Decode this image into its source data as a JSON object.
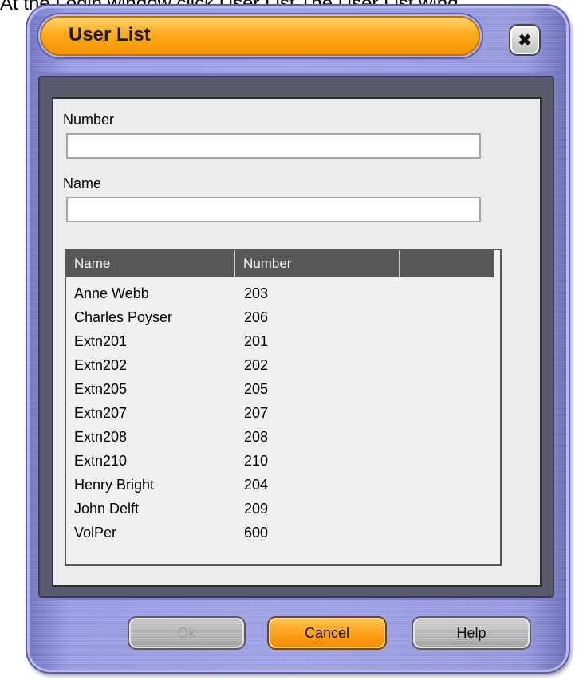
{
  "caption": "At the Login window click User List The User List wind",
  "window": {
    "title": "User List",
    "close_glyph": "✖"
  },
  "form": {
    "number_label": "Number",
    "number_value": "",
    "name_label": "Name",
    "name_value": ""
  },
  "list": {
    "columns": [
      "Name",
      "Number",
      ""
    ],
    "rows": [
      {
        "name": "Anne Webb",
        "number": "203"
      },
      {
        "name": "Charles Poyser",
        "number": "206"
      },
      {
        "name": "Extn201",
        "number": "201"
      },
      {
        "name": "Extn202",
        "number": "202"
      },
      {
        "name": "Extn205",
        "number": "205"
      },
      {
        "name": "Extn207",
        "number": "207"
      },
      {
        "name": "Extn208",
        "number": "208"
      },
      {
        "name": "Extn210",
        "number": "210"
      },
      {
        "name": "Henry Bright",
        "number": "204"
      },
      {
        "name": "John Delft",
        "number": "209"
      },
      {
        "name": "VolPer",
        "number": "600"
      }
    ]
  },
  "buttons": {
    "ok": {
      "mnemonic": "O",
      "rest": "k",
      "enabled": false
    },
    "cancel": {
      "pre": "C",
      "mnemonic": "a",
      "rest": "ncel"
    },
    "help": {
      "mnemonic": "H",
      "rest": "elp"
    }
  },
  "colors": {
    "frame": "#a3a6ea",
    "title_accent": "#ffac1c",
    "header_bg": "#585858"
  }
}
